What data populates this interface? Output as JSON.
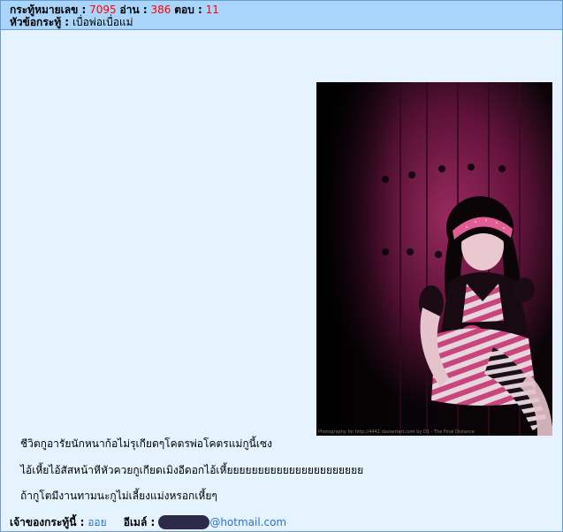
{
  "topic": {
    "number_label": "กระทู้หมายเลข :",
    "number": "7095",
    "read_label": "อ่าน :",
    "read_count": "386",
    "reply_label": "ตอบ :",
    "reply_count": "11",
    "title_label": "หัวข้อกระทู้ :",
    "title": "เบื่อพ่อเบื่อแม่"
  },
  "image": {
    "caption": "Photography for http://4442.deviantart.com by D1 - The Final Distance"
  },
  "body": {
    "paragraphs": [
      "ชีวิตกูอารัยนักหนาก้อไม่รุเกียดๆโคตรพ่อโคตรแม่กูนี้เซง",
      "ไอ้เหี้ยไอ้สัสหน้าหีหัวควยกูเกียดเมิงอีดอกไอ้เหี้ยยยยยยยยยยยยยยยยยยยยยย",
      "ถ้ากูโตมีงานทามนะกูไม่เลี้ยงแม่งหรอกเหี้ยๆ"
    ]
  },
  "owner": {
    "label": "เจ้าของกระทู้นี้ :",
    "name": "ออย",
    "email_label": "อีเมล์ :",
    "email_domain": "@hotmail.com"
  },
  "colors": {
    "header_bg": "#a9d5fb",
    "content_bg": "#e4f3ff",
    "accent_red": "#ff0000",
    "link_blue": "#2f6fd0"
  }
}
